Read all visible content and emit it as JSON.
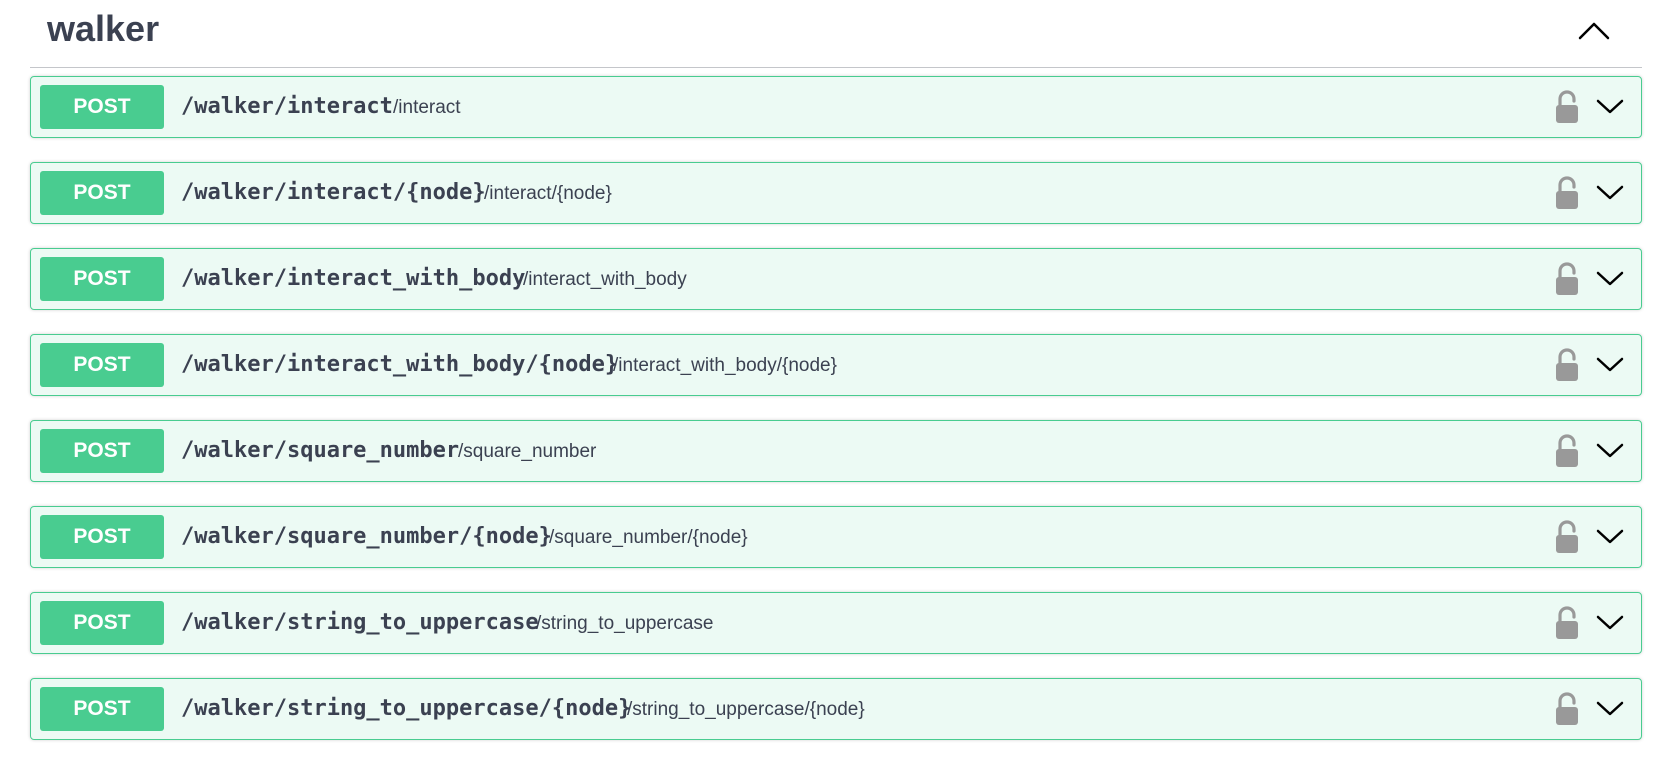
{
  "section": {
    "title": "walker",
    "collapse_icon": "chevron-up-icon"
  },
  "operations": [
    {
      "method": "POST",
      "path": "/walker/interact",
      "summary": "/interact"
    },
    {
      "method": "POST",
      "path": "/walker/interact/{node}",
      "summary": "/interact/{node}"
    },
    {
      "method": "POST",
      "path": "/walker/interact_with_body",
      "summary": "/interact_with_body"
    },
    {
      "method": "POST",
      "path": "/walker/interact_with_body/{node}",
      "summary": "/interact_with_body/{node}"
    },
    {
      "method": "POST",
      "path": "/walker/square_number",
      "summary": "/square_number"
    },
    {
      "method": "POST",
      "path": "/walker/square_number/{node}",
      "summary": "/square_number/{node}"
    },
    {
      "method": "POST",
      "path": "/walker/string_to_uppercase",
      "summary": "/string_to_uppercase"
    },
    {
      "method": "POST",
      "path": "/walker/string_to_uppercase/{node}",
      "summary": "/string_to_uppercase/{node}"
    }
  ],
  "icons": {
    "lock": "lock-icon",
    "expand": "chevron-down-icon"
  },
  "colors": {
    "post_accent": "#49cc90",
    "post_background": "#ecf7f1",
    "text": "#3b4151",
    "lock": "#999999"
  }
}
